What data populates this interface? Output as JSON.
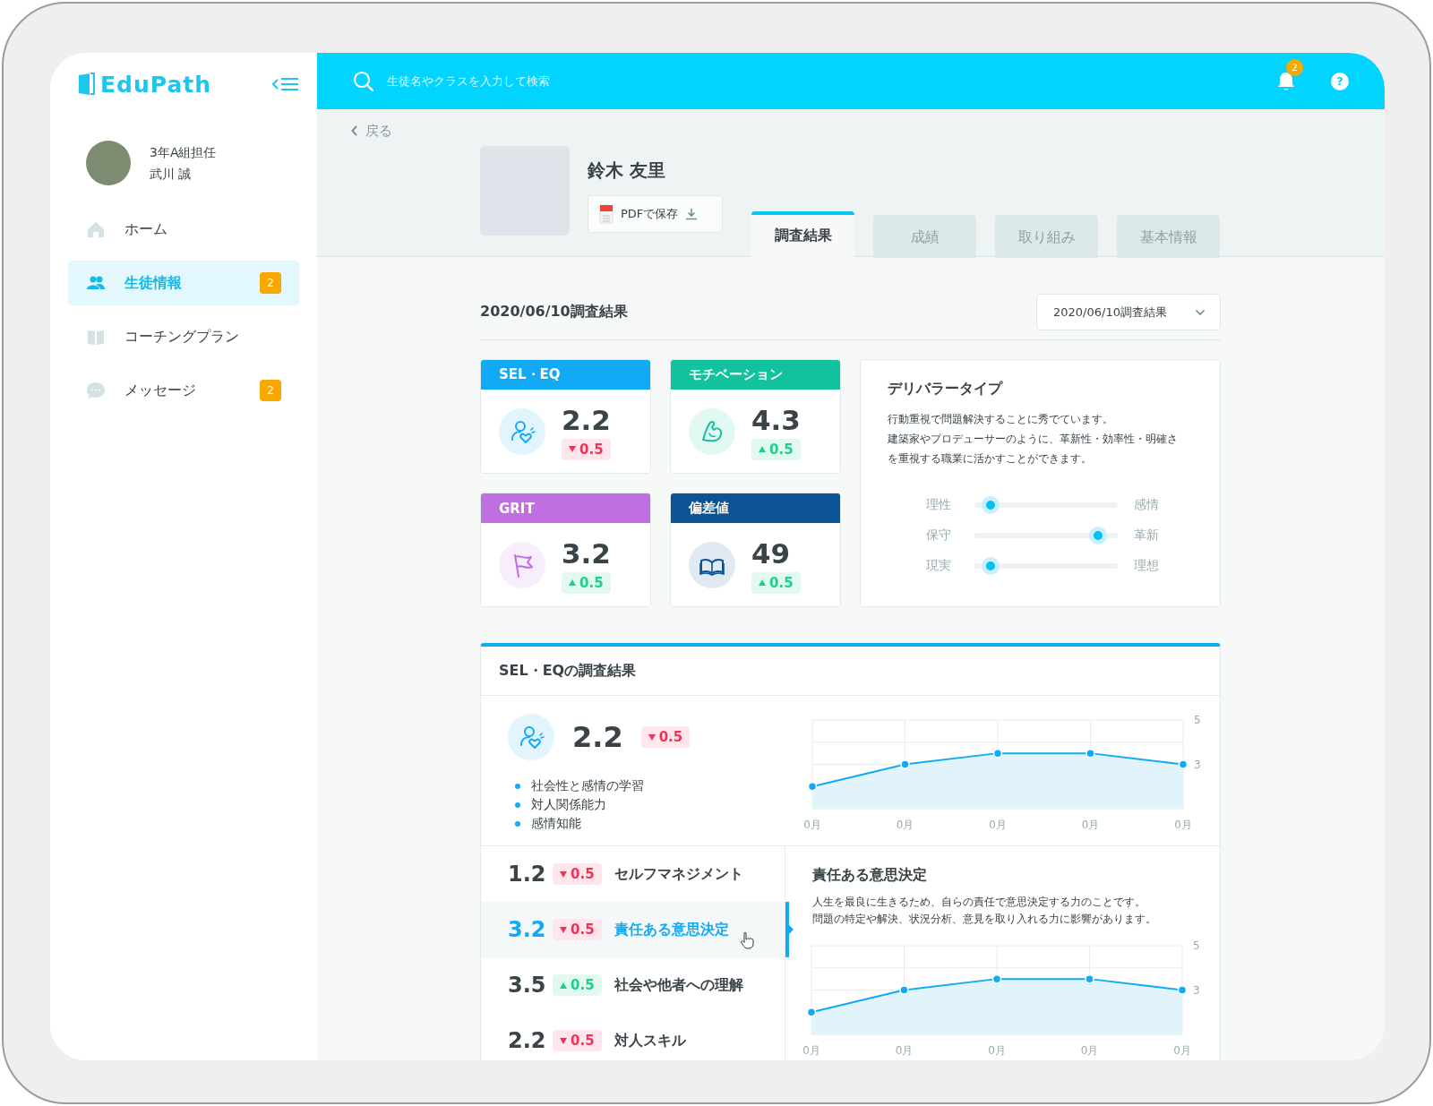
{
  "app": {
    "logo": "EduPath"
  },
  "user": {
    "role": "3年A組担任",
    "name": "武川 誠"
  },
  "nav": [
    {
      "label": "ホーム",
      "kind": "home",
      "selected": false
    },
    {
      "label": "生徒情報",
      "kind": "people",
      "selected": true,
      "badge": "2"
    },
    {
      "label": "コーチングプラン",
      "kind": "book",
      "selected": false
    },
    {
      "label": "メッセージ",
      "kind": "chat",
      "selected": false,
      "badge": "2"
    }
  ],
  "search": {
    "placeholder": "生徒名やクラスを入力して検索"
  },
  "notifications": {
    "badge": "2"
  },
  "help": {
    "glyph": "?"
  },
  "back": {
    "label": "戻る"
  },
  "student": {
    "name": "鈴木 友里",
    "pdf_button": "PDFで保存"
  },
  "tabs": [
    {
      "label": "調査結果",
      "selected": true
    },
    {
      "label": "成績",
      "selected": false
    },
    {
      "label": "取り組み",
      "selected": false
    },
    {
      "label": "基本情報",
      "selected": false
    }
  ],
  "survey": {
    "title": "2020/06/10調査結果",
    "select": "2020/06/10調査結果"
  },
  "score_cards": [
    {
      "title": "SEL・EQ",
      "kind": "person",
      "color": "#12aaf5",
      "value": "2.2",
      "delta": "0.5",
      "increase": false
    },
    {
      "title": "モチベーション",
      "kind": "arm",
      "color": "#12c29c",
      "value": "4.3",
      "delta": "0.5",
      "increase": true
    },
    {
      "title": "GRIT",
      "kind": "flag",
      "color": "#c06fe0",
      "value": "3.2",
      "delta": "0.5",
      "increase": true
    },
    {
      "title": "偏差値",
      "kind": "book",
      "color": "#0b5394",
      "value": "49",
      "delta": "0.5",
      "increase": true
    }
  ],
  "deliberator": {
    "title": "デリバラータイプ",
    "lines": [
      "行動重視で問題解決することに秀でています。",
      "建築家やプロデューサーのように、革新性・効率性・明確さ",
      "を重視する職業に活かすことができます。"
    ],
    "scales": [
      {
        "left": "理性",
        "right": "感情",
        "level": 0.11
      },
      {
        "left": "保守",
        "right": "革新",
        "level": 0.86
      },
      {
        "left": "現実",
        "right": "理想",
        "level": 0.11
      }
    ]
  },
  "sel_section": {
    "title": "SEL・EQの調査結果",
    "value": "2.2",
    "delta": "0.5",
    "increase": false,
    "bullets": [
      "社会性と感情の学習",
      "対人関係能力",
      "感情知能"
    ],
    "chart_data": {
      "type": "area",
      "categories": [
        "0月",
        "0月",
        "0月",
        "0月",
        "0月"
      ],
      "values": [
        2,
        3,
        3.5,
        3.5,
        3
      ],
      "ylim": [
        1,
        5
      ],
      "yticks": [
        5,
        3
      ],
      "grid": true
    }
  },
  "subscores": [
    {
      "value": "1.2",
      "delta": "0.5",
      "increase": false,
      "label": "セルフマネジメント",
      "selected": false,
      "hover": false
    },
    {
      "value": "3.2",
      "delta": "0.5",
      "increase": false,
      "label": "責任ある意思決定",
      "selected": true,
      "hover": true
    },
    {
      "value": "3.5",
      "delta": "0.5",
      "increase": true,
      "label": "社会や他者への理解",
      "selected": false,
      "hover": false
    },
    {
      "value": "2.2",
      "delta": "0.5",
      "increase": false,
      "label": "対人スキル",
      "selected": false,
      "hover": false
    }
  ],
  "detail": {
    "title": "責任ある意思決定",
    "lines": [
      "人生を最良に生きるため、自らの責任で意思決定する力のことです。",
      "問題の特定や解決、状況分析、意見を取り入れる力に影響があります。"
    ],
    "chart_data": {
      "type": "area",
      "categories": [
        "0月",
        "0月",
        "0月",
        "0月",
        "0月"
      ],
      "values": [
        2,
        3,
        3.5,
        3.5,
        3
      ],
      "ylim": [
        1,
        5
      ],
      "yticks": [
        5,
        3
      ],
      "grid": true
    }
  }
}
